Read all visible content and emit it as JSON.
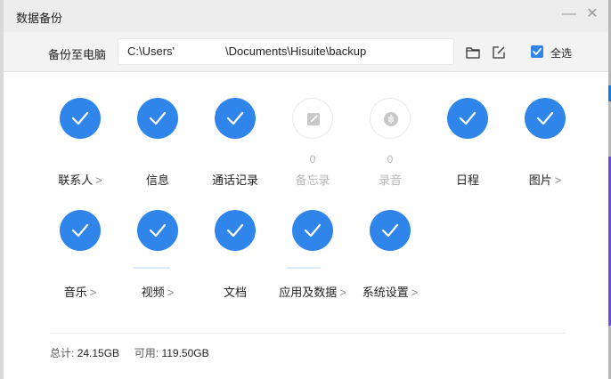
{
  "window": {
    "title": "数据备份",
    "minimize_glyph": "—",
    "close_glyph": "✕"
  },
  "toolbar": {
    "label": "备份至电脑",
    "path_part1": "C:\\Users'",
    "path_part2": "\\Documents\\Hisuite\\backup",
    "folder_icon": "folder-icon",
    "edit_icon": "edit-icon",
    "select_all_label": "全选",
    "select_all_checked": true
  },
  "items": [
    {
      "label": "联系人",
      "has_arrow": true,
      "selected": true,
      "count": ""
    },
    {
      "label": "信息",
      "has_arrow": false,
      "selected": true,
      "count": ""
    },
    {
      "label": "通话记录",
      "has_arrow": false,
      "selected": true,
      "count": ""
    },
    {
      "label": "备忘录",
      "has_arrow": false,
      "selected": false,
      "count": "0",
      "icon": "memo-icon"
    },
    {
      "label": "录音",
      "has_arrow": false,
      "selected": false,
      "count": "0",
      "icon": "recording-icon"
    },
    {
      "label": "日程",
      "has_arrow": false,
      "selected": true,
      "count": ""
    },
    {
      "label": "图片",
      "has_arrow": true,
      "selected": true,
      "count": ""
    },
    {
      "label": "音乐",
      "has_arrow": true,
      "selected": true,
      "count": ""
    },
    {
      "label": "视频",
      "has_arrow": true,
      "selected": true,
      "count": ""
    },
    {
      "label": "文档",
      "has_arrow": false,
      "selected": true,
      "count": ""
    },
    {
      "label": "应用及数据",
      "has_arrow": true,
      "selected": true,
      "count": ""
    },
    {
      "label": "系统设置",
      "has_arrow": true,
      "selected": true,
      "count": ""
    }
  ],
  "arrow_glyph": ">",
  "footer": {
    "total_label": "总计:",
    "total_value": "24.15GB",
    "available_label": "可用:",
    "available_value": "119.50GB"
  },
  "colors": {
    "accent": "#2f85ea",
    "disabled_icon": "#c8c8c8"
  }
}
